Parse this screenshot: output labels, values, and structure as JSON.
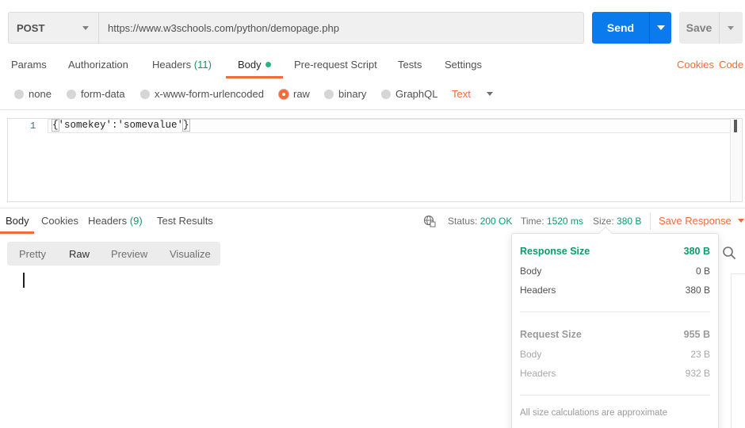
{
  "request": {
    "method": "POST",
    "url": "https://www.w3schools.com/python/demopage.php",
    "send_label": "Send",
    "save_label": "Save"
  },
  "request_tabs": {
    "params": "Params",
    "authorization": "Authorization",
    "headers": "Headers",
    "headers_count": "(11)",
    "body": "Body",
    "prerequest": "Pre-request Script",
    "tests": "Tests",
    "settings": "Settings",
    "cookies": "Cookies",
    "code": "Code"
  },
  "body_types": {
    "none": "none",
    "form_data": "form-data",
    "urlencoded": "x-www-form-urlencoded",
    "raw": "raw",
    "binary": "binary",
    "graphql": "GraphQL",
    "selected": "raw",
    "format": "Text"
  },
  "editor": {
    "line_number": "1",
    "code": "'somekey':'somevalue'",
    "brace_open": "{",
    "brace_close": "}"
  },
  "response_tabs": {
    "body": "Body",
    "cookies": "Cookies",
    "headers": "Headers",
    "headers_count": "(9)",
    "test_results": "Test Results"
  },
  "response_status": {
    "status_label": "Status:",
    "status_value": "200 OK",
    "time_label": "Time:",
    "time_value": "1520 ms",
    "size_label": "Size:",
    "size_value": "380 B",
    "save_response": "Save Response"
  },
  "views": {
    "pretty": "Pretty",
    "raw": "Raw",
    "preview": "Preview",
    "visualize": "Visualize",
    "selected": "Raw"
  },
  "size_popover": {
    "response_title": "Response Size",
    "response_total": "380 B",
    "response_body_label": "Body",
    "response_body": "0 B",
    "response_headers_label": "Headers",
    "response_headers": "380 B",
    "request_title": "Request Size",
    "request_total": "955 B",
    "request_body_label": "Body",
    "request_body": "23 B",
    "request_headers_label": "Headers",
    "request_headers": "932 B",
    "note": "All size calculations are approximate"
  },
  "colors": {
    "accent": "#f26b3a",
    "primary": "#097bed",
    "success": "#0c9b6c"
  }
}
